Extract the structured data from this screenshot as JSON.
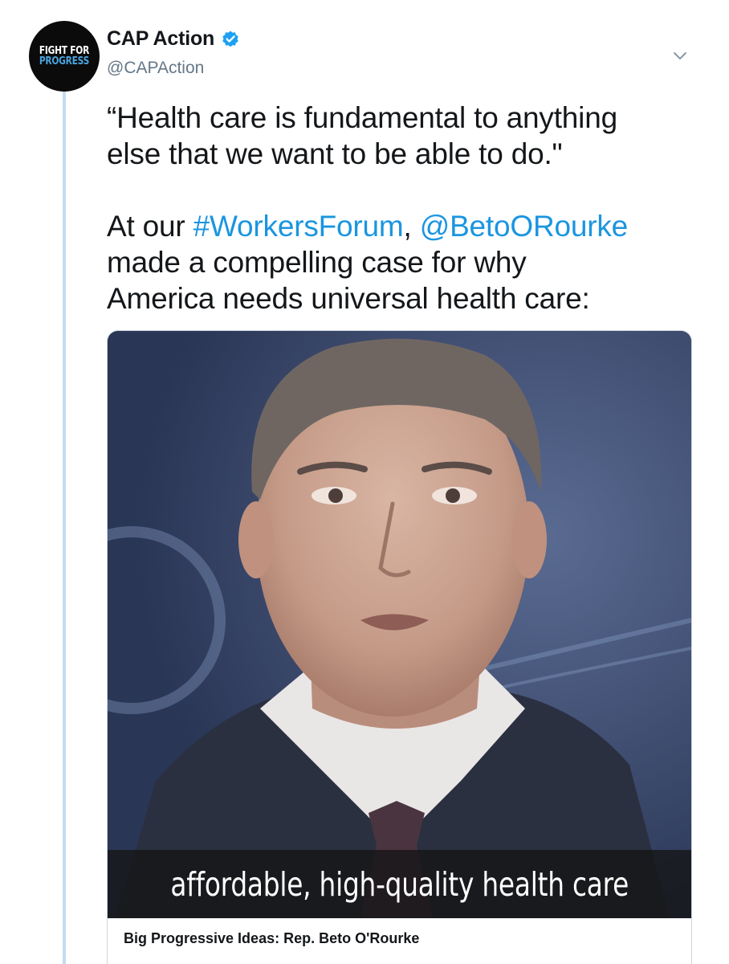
{
  "author": {
    "avatar_line1": "FIGHT FOR",
    "avatar_line2": "PROGRESS",
    "display_name": "CAP Action",
    "handle": "@CAPAction",
    "verified": true
  },
  "menu": {
    "icon": "chevron-down-icon"
  },
  "tweet": {
    "quote_line1": "“Health care is fundamental to anything",
    "quote_line2": "else that we want to be able to do.\"",
    "p2_prefix": "At our ",
    "hashtag": "#WorkersForum",
    "separator": ", ",
    "mention": "@BetoORourke",
    "p2_line2": "made a compelling case for why",
    "p2_line3": "America needs universal health care:"
  },
  "media": {
    "video_caption": "affordable, high-quality health care",
    "card_title": "Big Progressive Ideas: Rep. Beto O'Rourke"
  },
  "colors": {
    "link": "#1b95e0",
    "verified": "#1da1f2",
    "thread_line": "#c4dcef",
    "handle": "#657786"
  }
}
